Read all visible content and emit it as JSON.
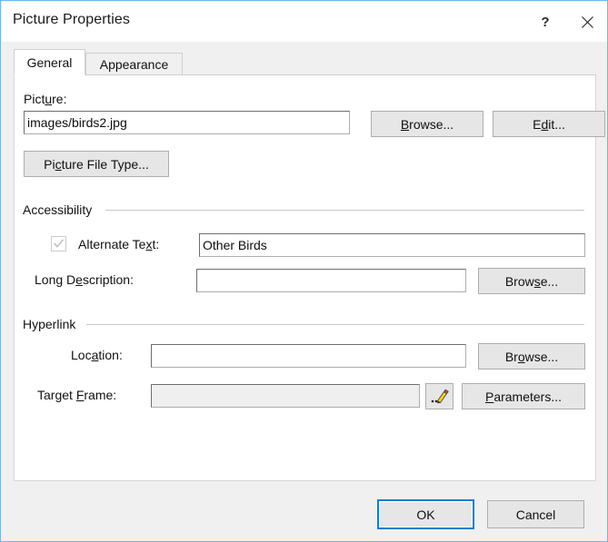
{
  "window": {
    "title": "Picture Properties",
    "help_icon": "question-mark-icon",
    "close_icon": "close-x-icon",
    "border_color": "#6cb8ea",
    "accent_color": "#0a7cd4"
  },
  "tabs": [
    {
      "label": "General",
      "selected": true
    },
    {
      "label": "Appearance",
      "selected": false
    }
  ],
  "general": {
    "picture": {
      "label_before": "Pict",
      "label_mnemonic": "u",
      "label_after": "re:",
      "value": "images/birds2.jpg",
      "placeholder": "",
      "browse_before": "",
      "browse_mnemonic": "B",
      "browse_after": "rowse...",
      "edit_before": "E",
      "edit_mnemonic": "d",
      "edit_after": "it...",
      "file_type_before": "Pi",
      "file_type_mnemonic": "c",
      "file_type_after": "ture File Type..."
    },
    "accessibility": {
      "group_label": "Accessibility",
      "checkbox_checked": true,
      "checkbox_disabled": true,
      "alt_before": "Alternate Te",
      "alt_mnemonic": "x",
      "alt_after": "t:",
      "alt_value": "Other Birds",
      "alt_placeholder": "",
      "long_before": "Long D",
      "long_mnemonic": "e",
      "long_after": "scription:",
      "long_value": "",
      "long_placeholder": "",
      "browse_before": "Brow",
      "browse_mnemonic": "s",
      "browse_after": "e..."
    },
    "hyperlink": {
      "group_label": "Hyperlink",
      "location_before": "Loc",
      "location_mnemonic": "a",
      "location_after": "tion:",
      "location_value": "",
      "location_placeholder": "",
      "location_browse_before": "Br",
      "location_browse_mnemonic": "o",
      "location_browse_after": "wse...",
      "target_before": "Target ",
      "target_mnemonic": "F",
      "target_after": "rame:",
      "target_value": "",
      "target_placeholder": "",
      "target_disabled": true,
      "pencil_icon": "ellipsis-pencil-icon",
      "parameters_before": "",
      "parameters_mnemonic": "P",
      "parameters_after": "arameters..."
    }
  },
  "footer": {
    "ok_label": "OK",
    "cancel_label": "Cancel",
    "default_button": "OK"
  }
}
